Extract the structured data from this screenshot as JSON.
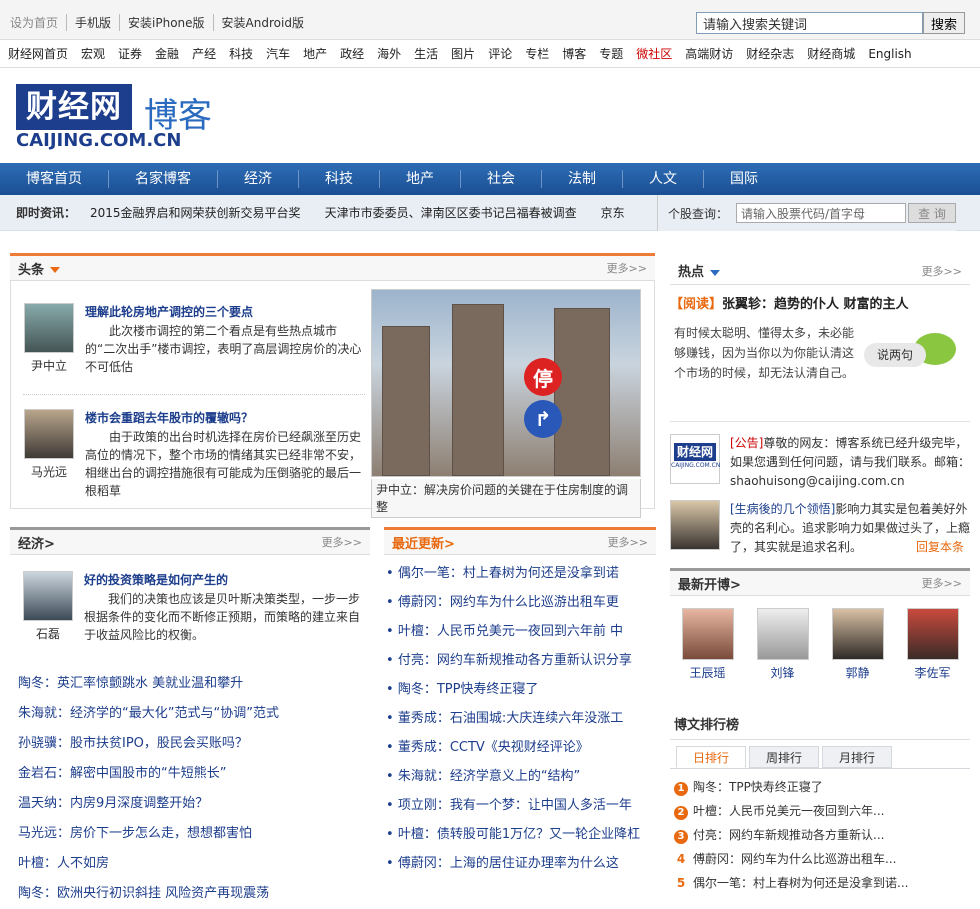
{
  "topbar": {
    "links": [
      "设为首页",
      "手机版",
      "安装iPhone版",
      "安装Android版"
    ],
    "search_placeholder": "请输入搜索关键词",
    "search_button": "搜索"
  },
  "channels": [
    "财经网首页",
    "宏观",
    "证券",
    "金融",
    "产经",
    "科技",
    "汽车",
    "地产",
    "政经",
    "海外",
    "生活",
    "图片",
    "评论",
    "专栏",
    "博客",
    "专题",
    "微社区",
    "高端财访",
    "财经杂志",
    "财经商城",
    "English"
  ],
  "brand": {
    "logo_text": "财经网",
    "logo_url": "CAIJING.COM.CN",
    "blog": "博客"
  },
  "mainnav": [
    "博客首页",
    "名家博客",
    "经济",
    "科技",
    "地产",
    "社会",
    "法制",
    "人文",
    "国际"
  ],
  "ticker": {
    "label": "即时资讯：",
    "items": [
      "2015金融界启和网荣获创新交易平台奖",
      "天津市市委委员、津南区区委书记吕福春被调查",
      "京东"
    ]
  },
  "stock": {
    "label": "个股查询：",
    "placeholder": "请输入股票代码/首字母",
    "button": "查 询"
  },
  "headline": {
    "title": "头条",
    "more": "更多>>",
    "stories": [
      {
        "author": "尹中立",
        "title": "理解此轮房地产调控的三个要点",
        "text": "此次楼市调控的第二个看点是有些热点城市的“二次出手”楼市调控，表明了高层调控房价的决心不可低估"
      },
      {
        "author": "马光远",
        "title": "楼市会重蹈去年股市的覆辙吗？",
        "text": "由于政策的出台时机选择在房价已经飙涨至历史高位的情况下，整个市场的情绪其实已经非常不安，相继出台的调控措施很有可能成为压倒骆驼的最后一根稻草"
      }
    ],
    "photo_caption": "尹中立：解决房价问题的关键在于住房制度的调整",
    "photo_sign": "停"
  },
  "economy": {
    "title": "经济>",
    "more": "更多>>",
    "feature": {
      "author": "石磊",
      "title": "好的投资策略是如何产生的",
      "text": "我们的决策也应该是贝叶斯决策类型，一步一步根据条件的变化而不断修正预期，而策略的建立来自于收益风险比的权衡。"
    },
    "items": [
      "陶冬：英汇率惊颤跳水 美就业温和攀升",
      "朱海就：经济学的“最大化”范式与“协调”范式",
      "孙骁骥：股市扶贫IPO，股民会买账吗？",
      "金岩石：解密中国股市的“牛短熊长”",
      "温天纳：内房9月深度调整开始？",
      "马光远：房价下一步怎么走，想想都害怕",
      "叶檀：人不如房",
      "陶冬：欧洲央行初识斜挂 风险资产再现震荡"
    ]
  },
  "latest": {
    "title": "最近更新>",
    "more": "更多>>",
    "items": [
      "偶尔一笔：村上春树为何还是没拿到诺",
      "傅蔚冈：网约车为什么比巡游出租车更",
      "叶檀：人民币兑美元一夜回到六年前 中",
      "付亮：网约车新规推动各方重新认识分享",
      "陶冬：TPP快寿终正寝了",
      "董秀成：石油围城:大庆连续六年没涨工",
      "董秀成：CCTV《央视财经评论》",
      "朱海就：经济学意义上的“结构”",
      "项立刚：我有一个梦：让中国人多活一年",
      "叶檀：债转股可能1万亿？又一轮企业降杠",
      "傅蔚冈：上海的居住证办理率为什么这"
    ]
  },
  "hot": {
    "title": "热点",
    "more": "更多>>",
    "feature_tag": "【阅读】",
    "feature_title": "张翼轸：趋势的仆人 财富的主人",
    "feature_text": "有时候太聪明、懂得太多，未必能够赚钱，因为当你以为你能认清这个市场的时候，却无法认清自己。",
    "bubble": "说两句",
    "notice_tag": "[公告]",
    "notice_text": "尊敬的网友：博客系统已经升级完毕，如果您遇到任何问题，请与我们联系。邮箱：shaohuisong@caijing.com.cn",
    "notice_logo": "财经网",
    "notice_logo_sub": "CAIJING.COM.CN",
    "qa_tag": "[生病後的几个领悟]",
    "qa_text": "影响力其实是包着美好外壳的名利心。追求影响力如果做过头了，上瘾了，其实就是追求名利。",
    "qa_reply": "回复本条"
  },
  "newblog": {
    "title": "最新开博>",
    "more": "更多>>",
    "people": [
      "王辰瑶",
      "刘锋",
      "郭静",
      "李佐军"
    ]
  },
  "ranking": {
    "title": "博文排行榜",
    "tabs": [
      "日排行",
      "周排行",
      "月排行"
    ],
    "items": [
      "陶冬：TPP快寿终正寝了",
      "叶檀：人民币兑美元一夜回到六年...",
      "付亮：网约车新规推动各方重新认...",
      "傅蔚冈：网约车为什么比巡游出租车...",
      "偶尔一笔：村上春树为何还是没拿到诺..."
    ]
  }
}
